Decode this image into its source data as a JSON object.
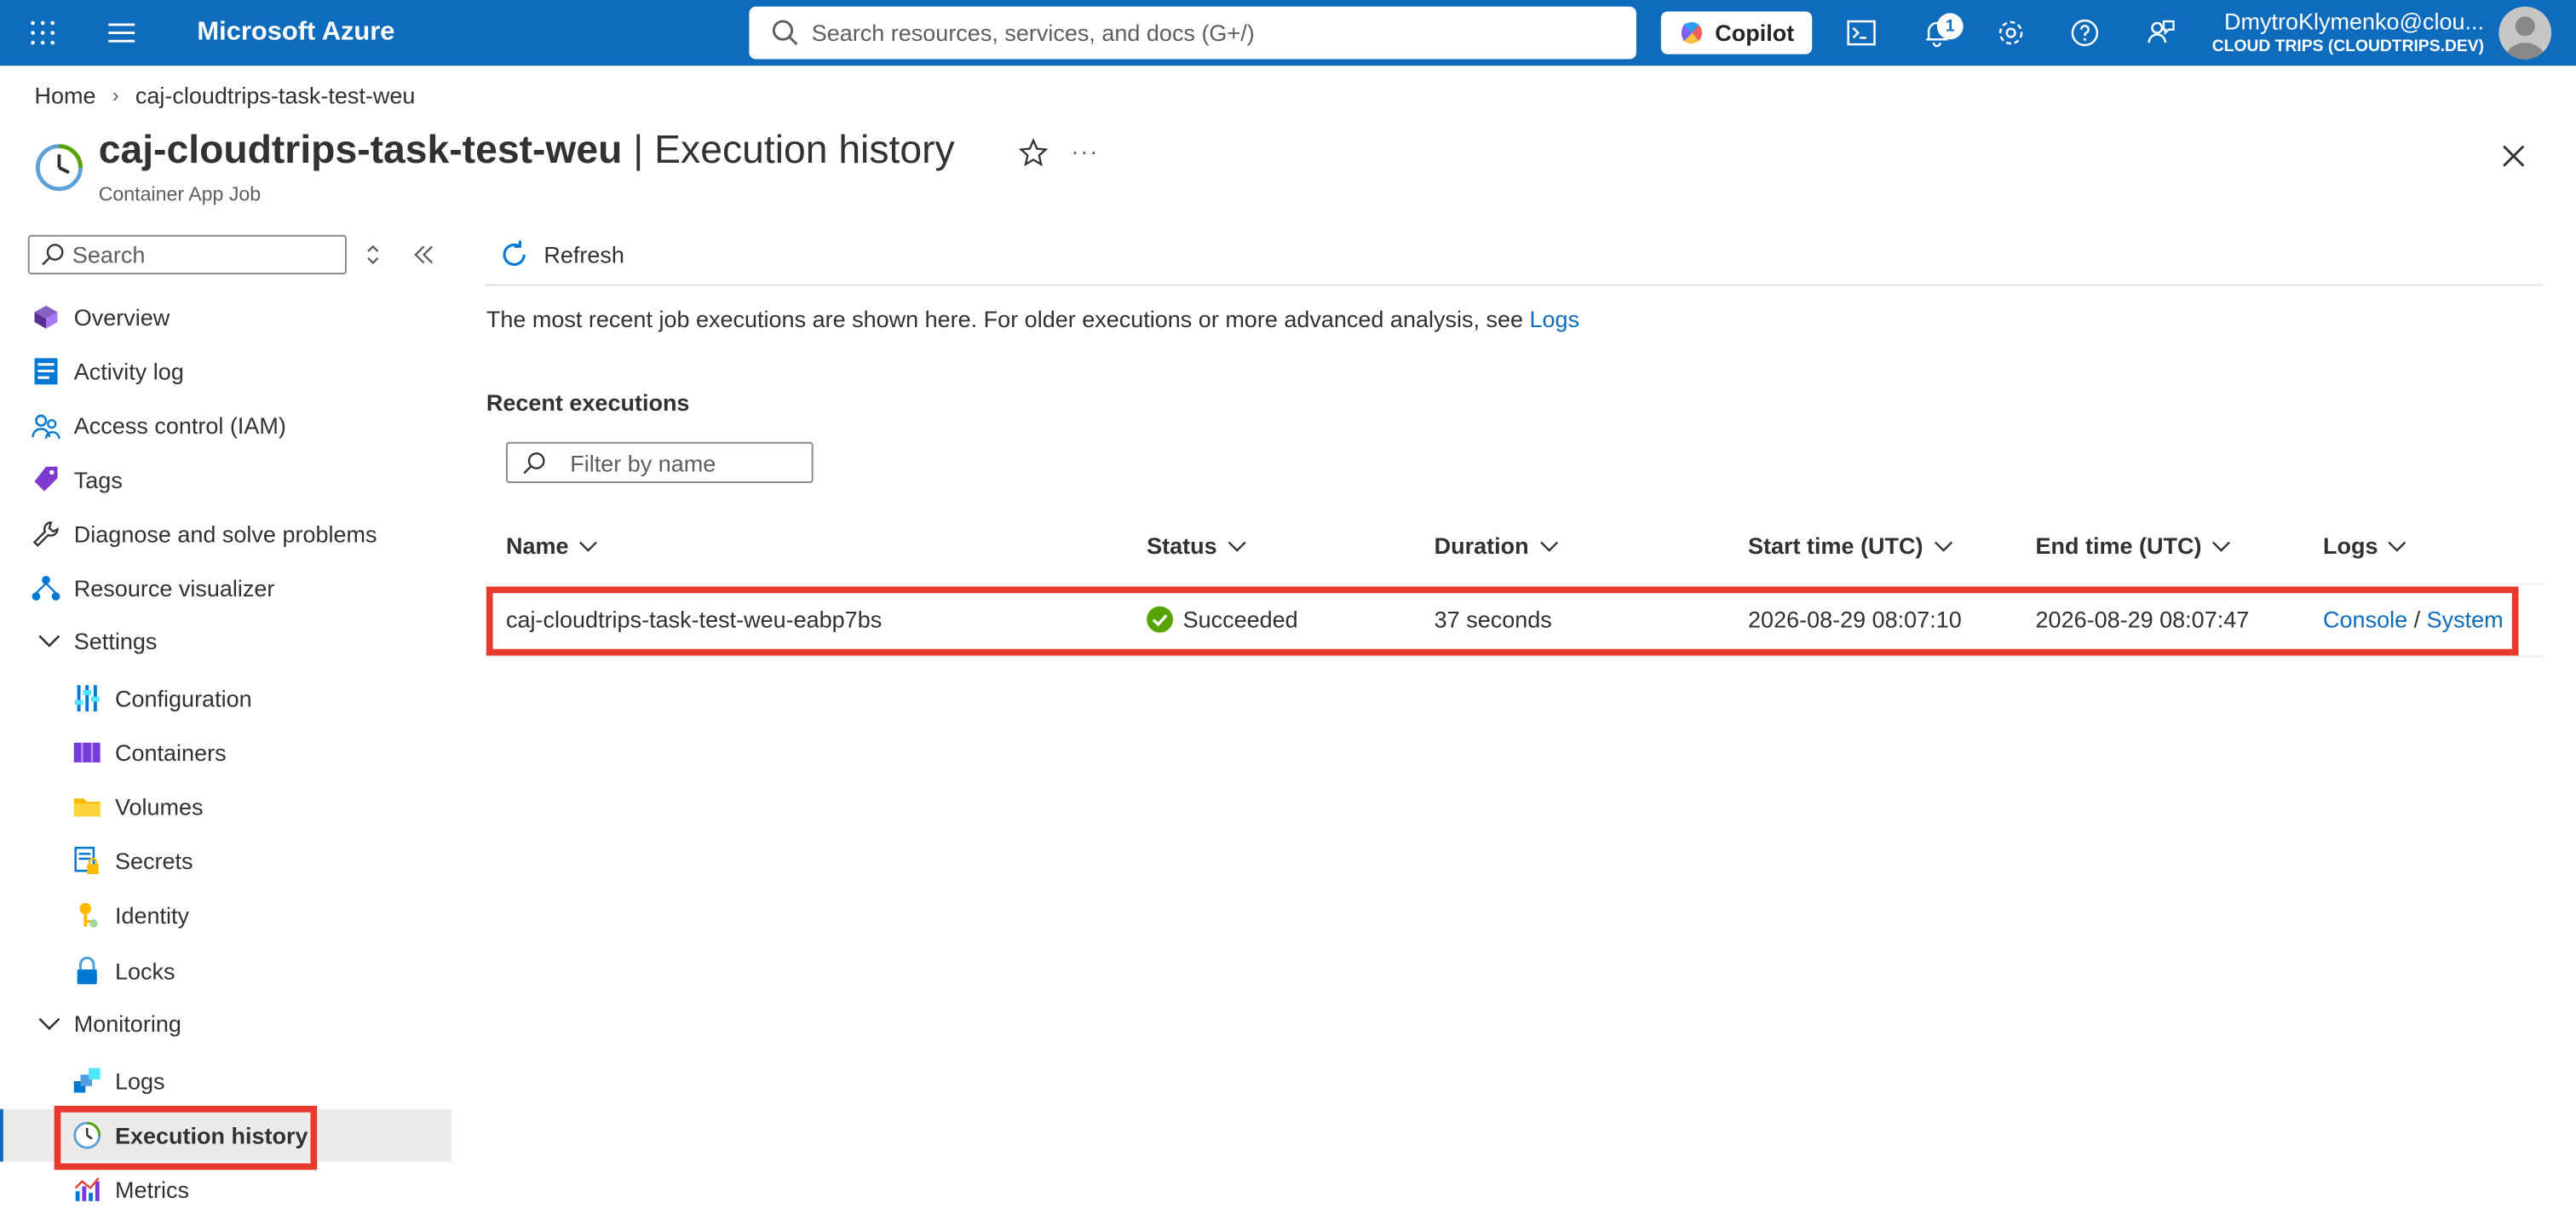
{
  "topbar": {
    "brand": "Microsoft Azure",
    "search_placeholder": "Search resources, services, and docs (G+/)",
    "copilot_label": "Copilot",
    "notification_count": "1",
    "user_email": "DmytroKlymenko@clou...",
    "tenant": "CLOUD TRIPS (CLOUDTRIPS.DEV)",
    "accent_color": "#0f6cbd"
  },
  "breadcrumb": {
    "home": "Home",
    "current": "caj-cloudtrips-task-test-weu"
  },
  "header": {
    "resource_name": "caj-cloudtrips-task-test-weu",
    "separator": " | ",
    "page": "Execution history",
    "resource_type": "Container App Job",
    "more": "···"
  },
  "sidebar": {
    "search_placeholder": "Search",
    "items": [
      {
        "label": "Overview",
        "icon": "overview-icon"
      },
      {
        "label": "Activity log",
        "icon": "activity-log-icon"
      },
      {
        "label": "Access control (IAM)",
        "icon": "iam-icon"
      },
      {
        "label": "Tags",
        "icon": "tag-icon"
      },
      {
        "label": "Diagnose and solve problems",
        "icon": "wrench-icon"
      },
      {
        "label": "Resource visualizer",
        "icon": "visualizer-icon"
      },
      {
        "label": "Settings",
        "icon": "chevron-down-icon"
      },
      {
        "label": "Configuration",
        "icon": "configuration-icon"
      },
      {
        "label": "Containers",
        "icon": "containers-icon"
      },
      {
        "label": "Volumes",
        "icon": "folder-icon"
      },
      {
        "label": "Secrets",
        "icon": "secrets-icon"
      },
      {
        "label": "Identity",
        "icon": "identity-icon"
      },
      {
        "label": "Locks",
        "icon": "lock-icon"
      },
      {
        "label": "Monitoring",
        "icon": "chevron-down-icon"
      },
      {
        "label": "Logs",
        "icon": "logs-icon"
      },
      {
        "label": "Execution history",
        "icon": "clock-icon",
        "active": true
      },
      {
        "label": "Metrics",
        "icon": "metrics-icon"
      }
    ]
  },
  "main": {
    "refresh_label": "Refresh",
    "info_text": "The most recent job executions are shown here. For older executions or more advanced analysis, see ",
    "info_link": "Logs",
    "section_title": "Recent executions",
    "filter_placeholder": "Filter by name",
    "columns": [
      "Name",
      "Status",
      "Duration",
      "Start time (UTC)",
      "End time (UTC)",
      "Logs"
    ],
    "rows": [
      {
        "name": "caj-cloudtrips-task-test-weu-eabp7bs",
        "status": "Succeeded",
        "status_color": "#57a300",
        "duration": "37 seconds",
        "start": "2026-08-29 08:07:10",
        "end": "2026-08-29 08:07:47",
        "log_console": "Console",
        "log_sep": " / ",
        "log_system": "System"
      }
    ]
  },
  "highlight_color": "#e8392d"
}
